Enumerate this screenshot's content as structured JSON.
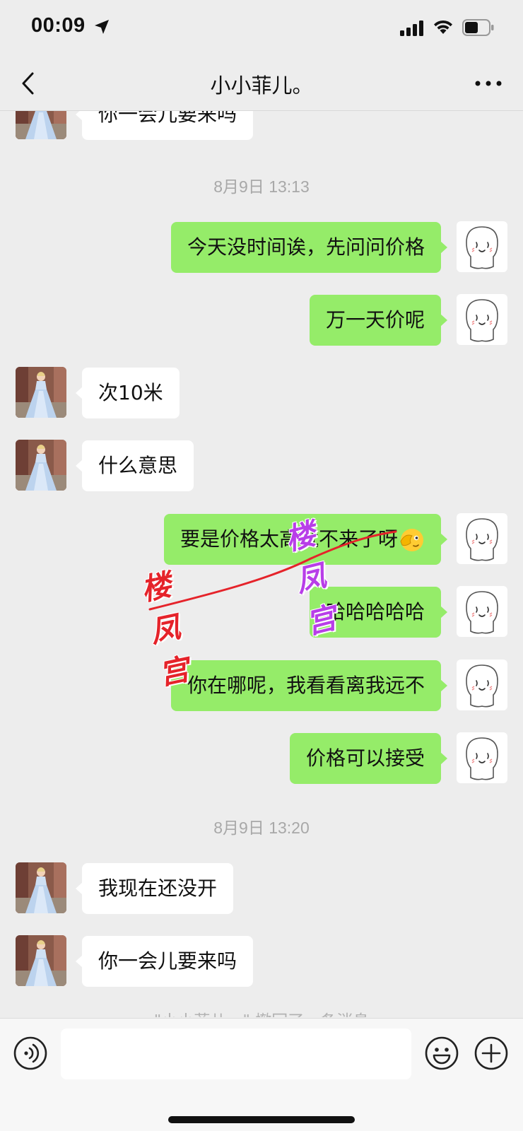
{
  "status_bar": {
    "time": "00:09",
    "icons": [
      "location-arrow-icon",
      "cellular-signal-icon",
      "wifi-icon",
      "battery-icon"
    ]
  },
  "nav": {
    "title": "小小菲儿。",
    "back_icon": "chevron-left-icon",
    "more_icon": "ellipsis-icon"
  },
  "chat": {
    "partial_top_message": "你一会儿要来吗",
    "groups": [
      {
        "timestamp": "8月9日 13:13",
        "messages": [
          {
            "side": "right",
            "text": "今天没时间诶，先问问价格"
          },
          {
            "side": "right",
            "text": "万一天价呢"
          },
          {
            "side": "left",
            "text": "次10米"
          },
          {
            "side": "left",
            "text": "什么意思"
          },
          {
            "side": "right",
            "text": "要是价格太高就不来了呀"
          },
          {
            "side": "right",
            "text": "哈哈哈哈哈"
          },
          {
            "side": "right",
            "text": "你在哪呢，我看看离我远不"
          },
          {
            "side": "right",
            "text": "价格可以接受"
          }
        ]
      },
      {
        "timestamp": "8月9日 13:20",
        "messages": [
          {
            "side": "left",
            "text": "我现在还没开"
          },
          {
            "side": "left",
            "text": "你一会儿要来吗"
          }
        ]
      }
    ],
    "recall_notice": "\"小小菲儿。\" 撤回了一条消息"
  },
  "watermark": {
    "text_1": "楼凤宫",
    "text_2": "楼凤宫"
  },
  "input_bar": {
    "placeholder": "",
    "voice_icon": "voice-icon",
    "emoji_icon": "smiley-icon",
    "plus_icon": "plus-icon"
  },
  "colors": {
    "background": "#ededed",
    "sent_bubble": "#95ec69",
    "received_bubble": "#ffffff",
    "timestamp_text": "#a8a8a8"
  }
}
